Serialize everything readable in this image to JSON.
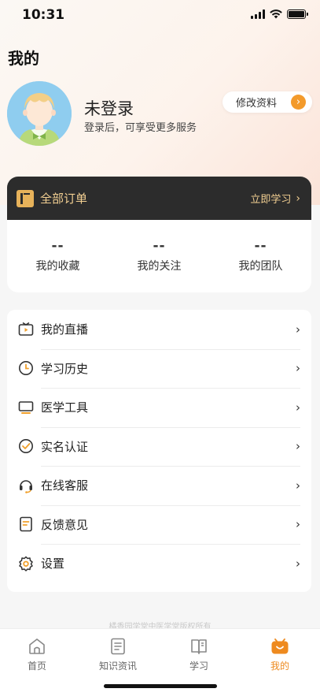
{
  "status_bar": {
    "time": "10:31"
  },
  "page_title": "我的",
  "user": {
    "name": "未登录",
    "subtitle": "登录后，可享受更多服务",
    "edit_label": "修改资料"
  },
  "orders": {
    "title": "全部订单",
    "link_label": "立即学习"
  },
  "stats": [
    {
      "value": "--",
      "label": "我的收藏"
    },
    {
      "value": "--",
      "label": "我的关注"
    },
    {
      "value": "--",
      "label": "我的团队"
    }
  ],
  "menu": [
    {
      "label": "我的直播",
      "icon": "tv-icon"
    },
    {
      "label": "学习历史",
      "icon": "clock-icon"
    },
    {
      "label": "医学工具",
      "icon": "monitor-icon"
    },
    {
      "label": "实名认证",
      "icon": "check-circle-icon"
    },
    {
      "label": "在线客服",
      "icon": "headset-icon"
    },
    {
      "label": "反馈意见",
      "icon": "document-icon"
    },
    {
      "label": "设置",
      "icon": "gear-icon"
    }
  ],
  "copyright": "橘香园学堂中医学堂版权所有",
  "tabs": [
    {
      "label": "首页",
      "icon": "home-icon"
    },
    {
      "label": "知识资讯",
      "icon": "news-icon"
    },
    {
      "label": "学习",
      "icon": "book-icon"
    },
    {
      "label": "我的",
      "icon": "profile-icon",
      "active": true
    }
  ],
  "colors": {
    "accent": "#ee8a1f",
    "gold": "#f2cf92",
    "dark_header": "#2c2c2c"
  }
}
